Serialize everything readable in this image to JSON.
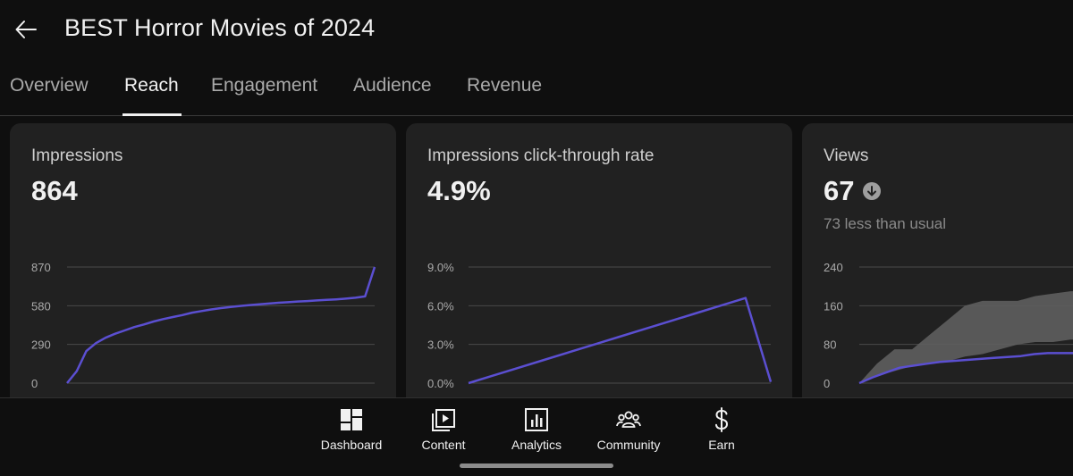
{
  "header": {
    "back_icon": "arrow-left-icon",
    "title": "BEST Horror Movies of 2024"
  },
  "tabs": [
    {
      "label": "Overview",
      "active": false
    },
    {
      "label": "Reach",
      "active": true
    },
    {
      "label": "Engagement",
      "active": false
    },
    {
      "label": "Audience",
      "active": false
    },
    {
      "label": "Revenue",
      "active": false
    }
  ],
  "cards": [
    {
      "label": "Impressions",
      "value": "864",
      "chart_data": {
        "type": "line",
        "title": "",
        "ylim": [
          0,
          870
        ],
        "yticks": [
          "870",
          "580",
          "290",
          "0"
        ],
        "series": [
          {
            "values": [
              0,
              90,
              240,
              300,
              340,
              370,
              395,
              420,
              440,
              462,
              480,
              495,
              510,
              528,
              540,
              552,
              562,
              570,
              578,
              585,
              590,
              596,
              602,
              606,
              612,
              615,
              620,
              624,
              628,
              633,
              640,
              650,
              870
            ],
            "color": "#5b4fd1"
          }
        ]
      }
    },
    {
      "label": "Impressions click-through rate",
      "value": "4.9%",
      "chart_data": {
        "type": "line",
        "title": "",
        "ylim": [
          0,
          9
        ],
        "yticks": [
          "9.0%",
          "6.0%",
          "3.0%",
          "0.0%"
        ],
        "series": [
          {
            "values": [
              0,
              0.6,
              1.2,
              1.8,
              2.4,
              3.0,
              3.6,
              4.2,
              4.8,
              5.4,
              6.0,
              6.6,
              0.1
            ],
            "color": "#5b4fd1"
          }
        ]
      }
    },
    {
      "label": "Views",
      "value": "67",
      "trend_icon": "arrow-down-circle-icon",
      "sub": "73 less than usual",
      "chart_data": {
        "type": "line",
        "title": "",
        "ylim": [
          0,
          240
        ],
        "yticks": [
          "240",
          "160",
          "80",
          "0"
        ],
        "series": [
          {
            "values": [
              0,
              12,
              22,
              32,
              36,
              40,
              44,
              46,
              48,
              50,
              52,
              54,
              56,
              60,
              62,
              62,
              62,
              62
            ],
            "color": "#5b4fd1"
          }
        ],
        "usual_range": {
          "upper": [
            0,
            40,
            70,
            70,
            100,
            130,
            160,
            170,
            170,
            170,
            180,
            185,
            190,
            190
          ],
          "lower": [
            0,
            15,
            25,
            35,
            40,
            45,
            55,
            60,
            70,
            80,
            85,
            85,
            90,
            90
          ],
          "color": "#5e5e5e"
        }
      }
    }
  ],
  "bottom_nav": [
    {
      "label": "Dashboard",
      "icon": "dashboard-icon"
    },
    {
      "label": "Content",
      "icon": "content-icon"
    },
    {
      "label": "Analytics",
      "icon": "analytics-icon"
    },
    {
      "label": "Community",
      "icon": "community-icon"
    },
    {
      "label": "Earn",
      "icon": "earn-icon"
    }
  ]
}
